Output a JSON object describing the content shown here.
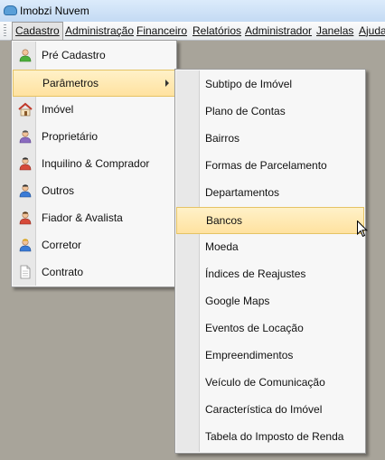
{
  "window": {
    "title": "Imobzi Nuvem"
  },
  "menubar": {
    "items": [
      {
        "label": "Cadastro"
      },
      {
        "label": "Administração"
      },
      {
        "label": "Financeiro"
      },
      {
        "label": "Relatórios"
      },
      {
        "label": "Administrador"
      },
      {
        "label": "Janelas"
      },
      {
        "label": "Ajuda"
      }
    ]
  },
  "cadastro_menu": {
    "items": [
      {
        "label": "Pré Cadastro",
        "icon": "person-green-icon"
      },
      {
        "label": "Parâmetros",
        "icon": "none",
        "highlighted": true,
        "has_submenu": true
      },
      {
        "label": "Imóvel",
        "icon": "house-icon"
      },
      {
        "label": "Proprietário",
        "icon": "person-purple-icon"
      },
      {
        "label": "Inquilino & Comprador",
        "icon": "person-red-icon"
      },
      {
        "label": "Outros",
        "icon": "person-blue-icon"
      },
      {
        "label": "Fiador & Avalista",
        "icon": "person-red-icon"
      },
      {
        "label": "Corretor",
        "icon": "person-blue-icon"
      },
      {
        "label": "Contrato",
        "icon": "document-icon"
      }
    ]
  },
  "parametros_menu": {
    "items": [
      {
        "label": "Subtipo de Imóvel"
      },
      {
        "label": "Plano de Contas"
      },
      {
        "label": "Bairros"
      },
      {
        "label": "Formas de Parcelamento"
      },
      {
        "label": "Departamentos"
      },
      {
        "label": "Bancos",
        "highlighted": true
      },
      {
        "label": "Moeda"
      },
      {
        "label": "Índices de Reajustes"
      },
      {
        "label": "Google Maps"
      },
      {
        "label": "Eventos de Locação"
      },
      {
        "label": "Empreendimentos"
      },
      {
        "label": "Veículo de Comunicação"
      },
      {
        "label": "Característica do Imóvel"
      },
      {
        "label": "Tabela do Imposto de Renda"
      }
    ]
  },
  "colors": {
    "desktop": "#a8a49a",
    "highlight": "#ffe2a0",
    "menu_bg": "#f7f7f7"
  }
}
